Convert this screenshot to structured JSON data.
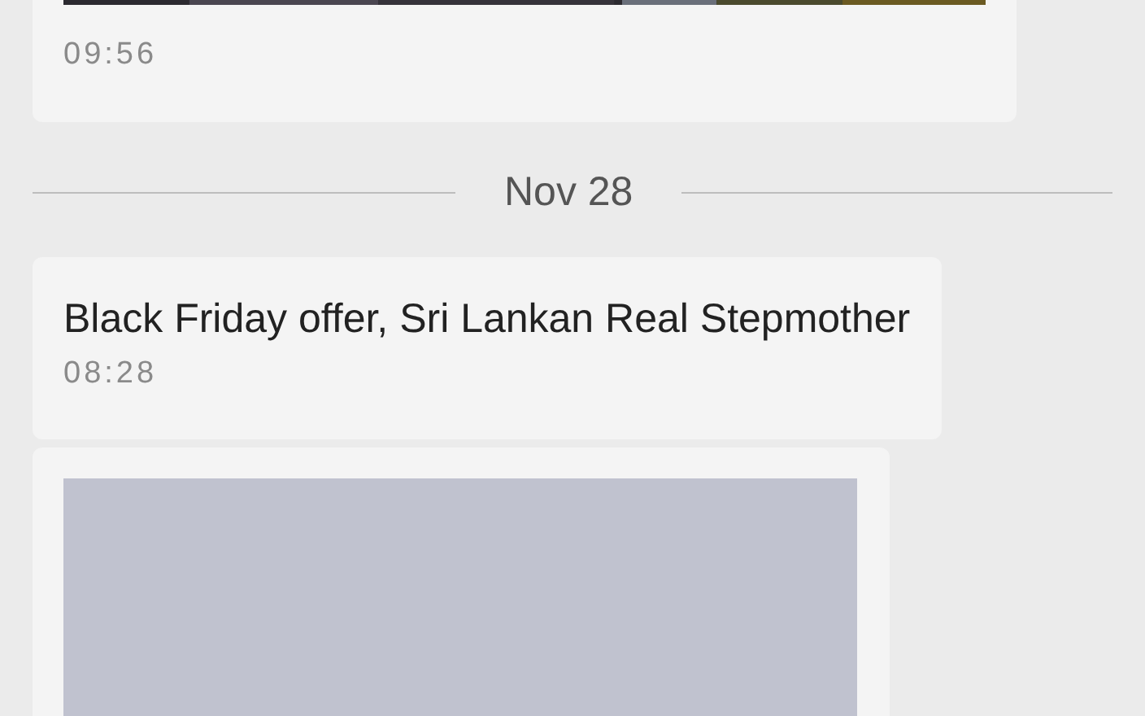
{
  "messages": [
    {
      "time": "09:56"
    },
    {
      "kind": "date",
      "label": "Nov 28"
    },
    {
      "kind": "text",
      "text": "Black Friday offer, Sri Lankan Real Stepmother",
      "time": "08:28"
    },
    {
      "kind": "loading_image"
    }
  ]
}
